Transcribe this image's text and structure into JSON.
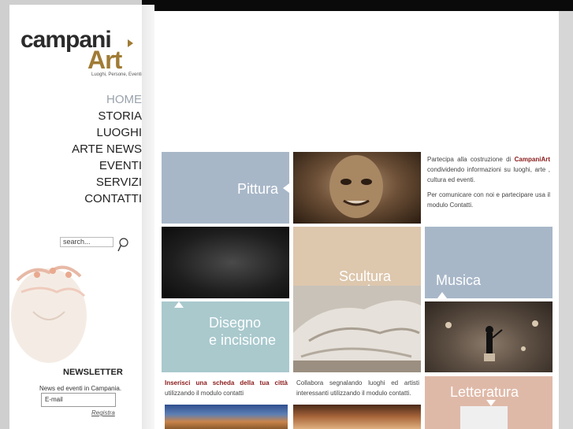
{
  "logo": {
    "text_main": "campani",
    "text_art": "Art",
    "tagline": "Luoghi, Persone, Eventi"
  },
  "nav": {
    "items": [
      {
        "label": "HOME",
        "active": true
      },
      {
        "label": "STORIA"
      },
      {
        "label": "LUOGHI"
      },
      {
        "label": "ARTE NEWS"
      },
      {
        "label": "EVENTI"
      },
      {
        "label": "SERVIZI"
      },
      {
        "label": "CONTATTI"
      }
    ]
  },
  "search": {
    "value": "search..."
  },
  "newsletter": {
    "title": "NEWSLETTER",
    "text": "News ed eventi in Campania.",
    "email_value": "E-mail",
    "register_label": "Registra"
  },
  "tiles": {
    "pittura": "Pittura",
    "scultura": "Scultura",
    "musica": "Musica",
    "disegno_1": "Disegno",
    "disegno_2": "e incisione",
    "letteratura": "Letteratura"
  },
  "info": {
    "p1_pre": "Partecipa alla costruzione di ",
    "p1_brand": "CampaniArt",
    "p1_post": " condividendo informazioni su luoghi, arte , cultura ed eventi.",
    "p2": "Per comunicare con noi e partecipare usa il modulo Contatti.",
    "scheda_bold": "Inserisci una scheda della tua città",
    "scheda_post": " utilizzando il modulo contatti",
    "collabora": "Collabora segnalando luoghi ed artisti interessanti utilizzando il modulo contatti."
  },
  "colors": {
    "pittura": "#a8b7c8",
    "scultura": "#ddc7ad",
    "musica": "#a8b7c8",
    "disegno": "#a9c9cd",
    "letteratura": "#dfb9a8",
    "brand_gold": "#a07b35"
  }
}
